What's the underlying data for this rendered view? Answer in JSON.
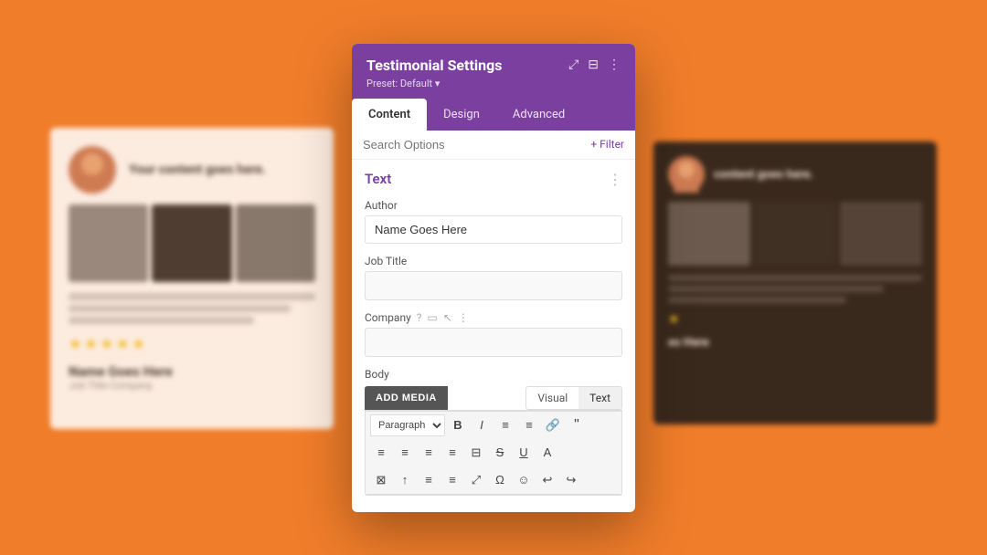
{
  "background": {
    "color": "#f07d2a"
  },
  "modal": {
    "header": {
      "title": "Testimonial Settings",
      "preset_label": "Preset: Default ▾",
      "icon_fullscreen": "⤢",
      "icon_columns": "⊞",
      "icon_more": "⋮"
    },
    "tabs": [
      {
        "label": "Content",
        "active": true
      },
      {
        "label": "Design",
        "active": false
      },
      {
        "label": "Advanced",
        "active": false
      }
    ],
    "search": {
      "placeholder": "Search Options",
      "filter_label": "+ Filter"
    },
    "sections": [
      {
        "title": "Text",
        "dots": "⋮",
        "fields": [
          {
            "label": "Author",
            "value": "Name Goes Here",
            "placeholder": "Name Goes Here",
            "type": "text"
          },
          {
            "label": "Job Title",
            "value": "",
            "placeholder": "",
            "type": "text"
          },
          {
            "label": "Company",
            "value": "",
            "placeholder": "",
            "type": "text",
            "has_icons": true
          }
        ]
      }
    ],
    "body_section": {
      "label": "Body",
      "add_media_label": "ADD MEDIA",
      "view_tabs": [
        {
          "label": "Visual",
          "active": false
        },
        {
          "label": "Text",
          "active": true
        }
      ],
      "toolbar_row1": [
        "Paragraph",
        "B",
        "I",
        "≡",
        "≡",
        "🔗",
        "❝"
      ],
      "toolbar_row2": [
        "≡",
        "≡",
        "≡",
        "≡",
        "⊟",
        "S",
        "U",
        "A"
      ],
      "toolbar_row3": [
        "⊠",
        "↑",
        "≡",
        "≡",
        "⤢",
        "Ω",
        "☺",
        "↩",
        "↪"
      ]
    }
  },
  "left_card": {
    "avatar_text": "Your content goes here.",
    "name": "Name Goes Here",
    "subtitle": "Job Title  Company"
  },
  "right_card": {
    "avatar_text": "content goes here.",
    "star_label": "★"
  }
}
